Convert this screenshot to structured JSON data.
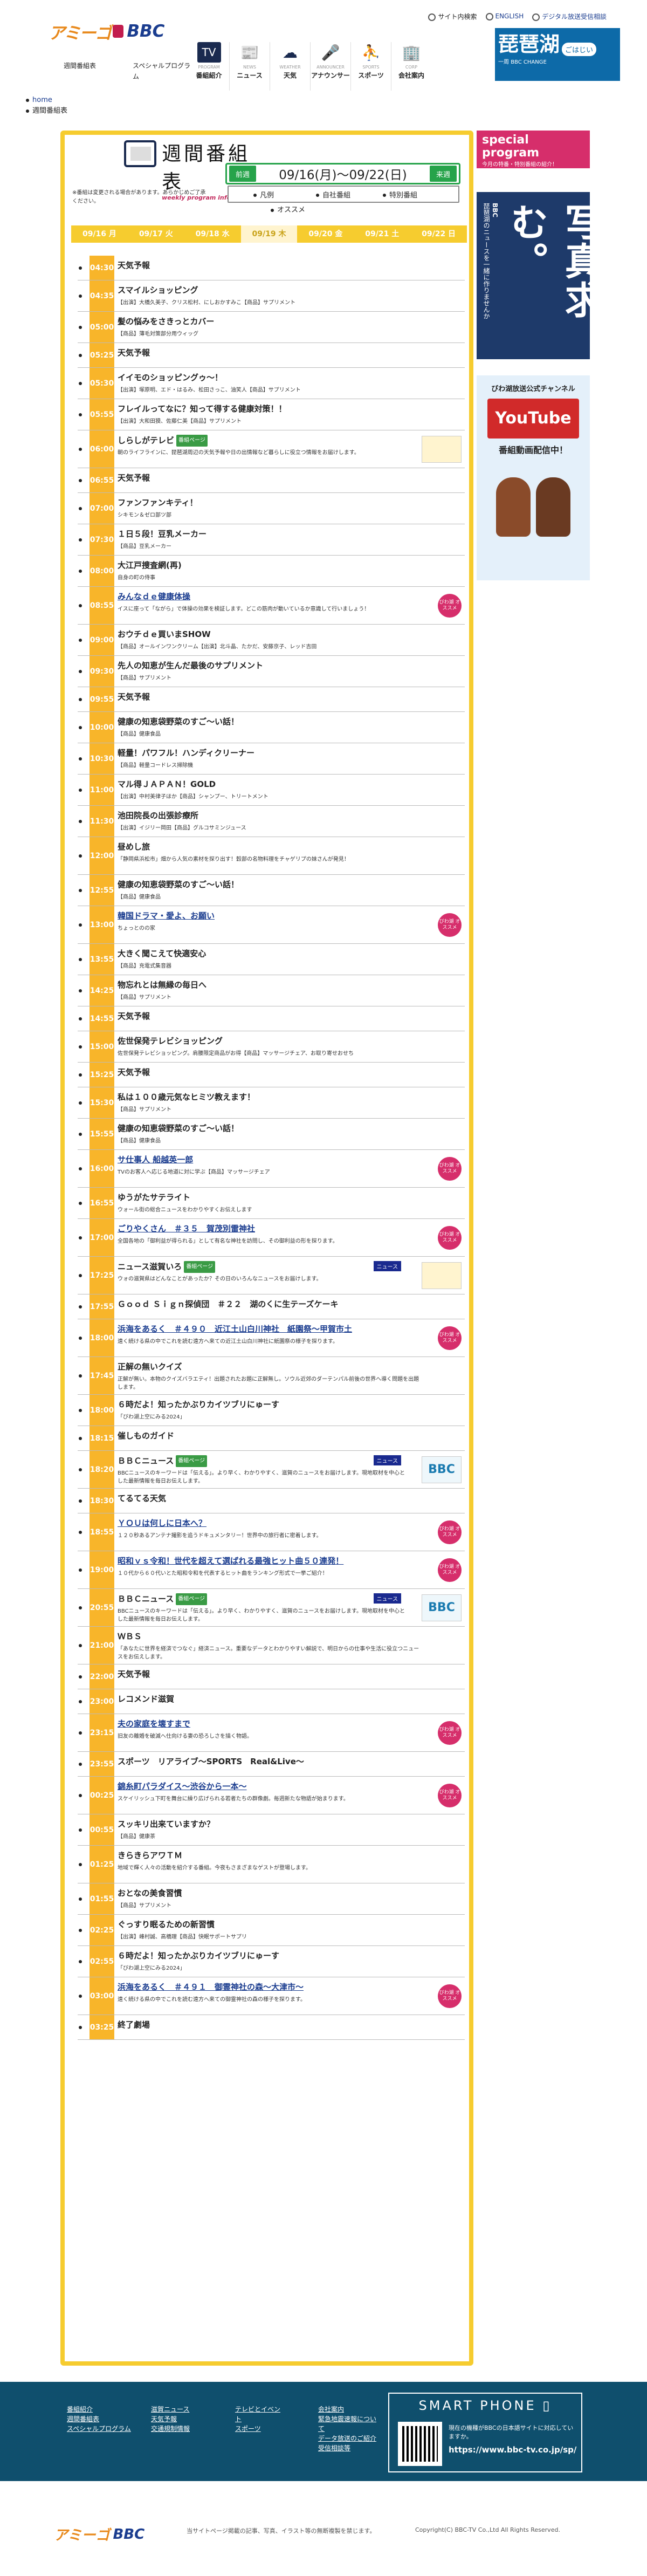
{
  "header": {
    "logo_a": "アミーゴ",
    "logo_b": "BBC",
    "tools": [
      "サイト内検索",
      "ENGLISH",
      "デジタル放送受信相談"
    ],
    "nav": [
      {
        "en": "PROGRAM",
        "ja": "番組紹介",
        "icon": "tv-icon",
        "glyph": "TV",
        "on": true
      },
      {
        "en": "NEWS",
        "ja": "ニュース",
        "icon": "news-icon",
        "glyph": "📰"
      },
      {
        "en": "WEATHER",
        "ja": "天気",
        "icon": "weather-icon",
        "glyph": "☁"
      },
      {
        "en": "ANNOUNCER",
        "ja": "アナウンサー",
        "icon": "microphone-icon",
        "glyph": "🎤"
      },
      {
        "en": "SPORTS",
        "ja": "スポーツ",
        "icon": "sports-icon",
        "glyph": "⛹"
      },
      {
        "en": "CORP",
        "ja": "会社案内",
        "icon": "building-icon",
        "glyph": "🏢"
      }
    ],
    "subnav": [
      "週間番組表",
      "スペシャルプログラム"
    ],
    "banner": {
      "title": "琵琶湖",
      "tag": "ごはじい",
      "sub": "一周",
      "small": "BBC CHANGE"
    }
  },
  "breadcrumb": [
    "home",
    "週間番組表"
  ],
  "page": {
    "title_ja": "週間番組表",
    "title_en": "weekly program information",
    "note": "※番組は変更される場合があります。あらかじめご了承ください。",
    "prev": "前週",
    "next": "来週",
    "range": "09/16(月)～09/22(日)",
    "filters": [
      "凡例",
      "自社番組",
      "特別番組"
    ],
    "recommend": "オススメ",
    "days": [
      "09/16 月",
      "09/17 火",
      "09/18 水",
      "09/19 木",
      "09/20 金",
      "09/21 土",
      "09/22 日"
    ]
  },
  "rows": [
    {
      "t": "04:30",
      "ti": "天気予報",
      "ds": "",
      "h": 34
    },
    {
      "t": "04:35",
      "ti": "スマイルショッピング",
      "ds": "【出演】大橋久美子、クリス松村、にしおかすみこ【商品】サプリメント",
      "h": 46
    },
    {
      "t": "05:00",
      "ti": "髪の悩みをさきっとカバー",
      "ds": "【商品】薄毛対策部分用ウィッグ",
      "h": 46
    },
    {
      "t": "05:25",
      "ti": "天気予報",
      "ds": "",
      "h": 34
    },
    {
      "t": "05:30",
      "ti": "イイモのショッピングゥ〜！",
      "ds": "【出演】塚原明、エド・はるみ、松田さっこ、油笑人【商品】サプリメント",
      "h": 46
    },
    {
      "t": "05:55",
      "ti": "フレイルってなに？知って得する健康対策！！",
      "ds": "【出演】大和田獏、佐藤仁美【商品】サプリメント",
      "h": 46
    },
    {
      "t": "06:00",
      "ti": "しらしがテレビ",
      "ds": "朝のライフラインに、琵琶湖周辺の天気予報や日の出情報など暮らしに役立つ情報をお届けします。",
      "h": 58,
      "badge": "番組ページ",
      "logo": true
    },
    {
      "t": "06:55",
      "ti": "天気予報",
      "ds": "",
      "h": 34
    },
    {
      "t": "07:00",
      "ti": "ファンファンキティ！",
      "ds": "シキモン＆ゼロ部ツ部",
      "h": 46
    },
    {
      "t": "07:30",
      "ti": "１日５段！豆乳メーカー",
      "ds": "【商品】豆乳メーカー",
      "h": 46
    },
    {
      "t": "08:00",
      "ti": "大江戸捜査網(再)",
      "ds": "自身の町の侍事",
      "h": 46
    },
    {
      "t": "08:55",
      "ti": "みんなｄｅ健康体操",
      "ds": "イスに座って「ながら」で体操の効果を検証します。どこの筋肉が動いているか意識して行いましょう！",
      "h": 58,
      "link": true,
      "tag": true
    },
    {
      "t": "09:00",
      "ti": "おウチｄｅ買いまSHOW",
      "ds": "【商品】オールインワンクリーム【出演】北斗晶、たかだ、安藤京子、レッド吉田",
      "h": 46
    },
    {
      "t": "09:30",
      "ti": "先人の知恵が生んだ最後のサプリメント",
      "ds": "【商品】サプリメント",
      "h": 46
    },
    {
      "t": "09:55",
      "ti": "天気予報",
      "ds": "",
      "h": 34
    },
    {
      "t": "10:00",
      "ti": "健康の知恵袋野菜のすご〜い話！",
      "ds": "【商品】健康食品",
      "h": 46
    },
    {
      "t": "10:30",
      "ti": "軽量！パワフル！ハンディクリーナー",
      "ds": "【商品】軽量コードレス掃除機",
      "h": 46
    },
    {
      "t": "11:00",
      "ti": "マル得ＪＡＰＡＮ！GOLD",
      "ds": "【出演】中村美律子ほか【商品】シャンプー、トリートメント",
      "h": 46
    },
    {
      "t": "11:30",
      "ti": "池田院長の出張診療所",
      "ds": "【出演】イジリー岡田【商品】グルコサミンジュース",
      "h": 46
    },
    {
      "t": "12:00",
      "ti": "昼めし旅",
      "ds": "「静岡県浜松市」畑から人気の素材を探り出す！穀部の名物料理をチャゲリプの妹さんが発見！",
      "h": 58
    },
    {
      "t": "12:55",
      "ti": "健康の知恵袋野菜のすご〜い話！",
      "ds": "【商品】健康食品",
      "h": 46
    },
    {
      "t": "13:00",
      "ti": "韓国ドラマ・愛よ、お願い",
      "ds": "ちょっとのの家",
      "h": 58,
      "link": true,
      "tag": true
    },
    {
      "t": "13:55",
      "ti": "大きく聞こえて快適安心",
      "ds": "【商品】充電式集音器",
      "h": 46
    },
    {
      "t": "14:25",
      "ti": "物忘れとは無縁の毎日へ",
      "ds": "【商品】サプリメント",
      "h": 46
    },
    {
      "t": "14:55",
      "ti": "天気予報",
      "ds": "",
      "h": 34
    },
    {
      "t": "15:00",
      "ti": "佐世保発テレビショッピング",
      "ds": "佐世保発テレビショッピング。肩腰限定商品がお得【商品】マッサージチェア、お取り寄せおせち",
      "h": 46
    },
    {
      "t": "15:25",
      "ti": "天気予報",
      "ds": "",
      "h": 34
    },
    {
      "t": "15:30",
      "ti": "私は１００歳元気なヒミツ教えます！",
      "ds": "【商品】サプリメント",
      "h": 46
    },
    {
      "t": "15:55",
      "ti": "健康の知恵袋野菜のすご〜い話！",
      "ds": "【商品】健康食品",
      "h": 46
    },
    {
      "t": "16:00",
      "ti": "サ仕事人 船越英一郎",
      "ds": "TVのお客人へ応じる地道に対に学ぶ【商品】マッサージチェア",
      "h": 58,
      "link": true,
      "tag": true
    },
    {
      "t": "16:55",
      "ti": "ゆうがたサテライト",
      "ds": "ウォール街の総合ニュースをわかりやすくお伝えします",
      "h": 46
    },
    {
      "t": "17:00",
      "ti": "ごりやくさん　＃３５　賀茂別雷神社",
      "ds": "全国各地の「御利益が得られる」として有名な神社を訪問し、その御利益の形を探ります。",
      "h": 58,
      "link": true,
      "tag": true
    },
    {
      "t": "17:25",
      "ti": "ニュース滋賀いろ",
      "ds": "ウォの滋賀県はどんなことがあったか？その日のいろんなニュースをお届けします。",
      "h": 58,
      "badge": "番組ページ",
      "news": true,
      "logo": true
    },
    {
      "t": "17:55",
      "ti": "Ｇｏｏｄ Ｓｉｇｎ探偵団　＃２２　湖のくに生テーズケーキ",
      "ds": "",
      "h": 34
    },
    {
      "t": "18:00",
      "ti": "浜海をあるく　＃４９０　近江土山白川神社　紙園祭〜甲賀市土",
      "ds": "遠く続ける県の中でこれを読む遠方へ来ての近江土山白川神社に紙園祭の様子を探ります。",
      "h": 58,
      "link": true,
      "tag": true
    },
    {
      "t": "17:45",
      "ti": "正解の無いクイズ",
      "ds": "正解が無い。本物のクイズバラエティ！出題されたお題に正解無し。ソウル近郊のダーテンパル前後の世界へ導く問題を出題します。",
      "h": 58
    },
    {
      "t": "18:00",
      "ti": "６時だよ！知ったかぶりカイツブリにゅーす",
      "ds": "「びわ湖上空にみる2024」",
      "h": 46
    },
    {
      "t": "18:15",
      "ti": "催しものガイド",
      "ds": "",
      "h": 34
    },
    {
      "t": "18:20",
      "ti": "ＢＢＣニュース",
      "ds": "BBCニュースのキーワードは「伝える」。より早く、わかりやすく、滋賀のニュースをお届けします。現地取材を中心とした最新情報を毎日お伝えします。",
      "h": 58,
      "badge": "番組ページ",
      "news": true,
      "bbc": true
    },
    {
      "t": "18:30",
      "ti": "てるてる天気",
      "ds": "",
      "h": 34
    },
    {
      "t": "18:55",
      "ti": "ＹＯＵは何しに日本へ？",
      "ds": "１２０秒あるアンテナ撮影を追うドキュメンタリー！世界中の旅行者に密着します。",
      "h": 58,
      "link": true,
      "tag": true
    },
    {
      "t": "19:00",
      "ti": "昭和ｖｓ令和！世代を超えて選ばれる最強ヒット曲５０連発！",
      "ds": "１０代から６０代いとた昭和令和を代表するヒット曲をランキング形式で一挙ご紹介！",
      "h": 58,
      "link": true,
      "tag": true
    },
    {
      "t": "20:55",
      "ti": "ＢＢＣニュース",
      "ds": "BBCニュースのキーワードは「伝える」。より早く、わかりやすく、滋賀のニュースをお届けします。現地取材を中心とした最新情報を毎日お伝えします。",
      "h": 58,
      "badge": "番組ページ",
      "news": true,
      "bbc": true
    },
    {
      "t": "21:00",
      "ti": "ＷＢＳ",
      "ds": "「あなたに世界を経済でつなぐ」経済ニュース。重要なデータとわかりやすい解説で、明日からの仕事や生活に役立つニュースをお伝えします。",
      "h": 58
    },
    {
      "t": "22:00",
      "ti": "天気予報",
      "ds": "",
      "h": 34
    },
    {
      "t": "23:00",
      "ti": "レコメンド滋賀",
      "ds": "",
      "h": 34
    },
    {
      "t": "23:15",
      "ti": "夫の家庭を壊すまで",
      "ds": "旧友の離婚を破滅へ仕向ける妻の恐ろしさを描く物語。",
      "h": 58,
      "link": true,
      "tag": true
    },
    {
      "t": "23:55",
      "ti": "スポーツ　リアライブ〜SPORTS　Real&Live〜",
      "ds": "",
      "h": 34
    },
    {
      "t": "00:25",
      "ti": "錦糸町パラダイス〜渋谷から一本〜",
      "ds": "スケイリッシュ下町を舞台に繰り広げられる若者たちの群像劇。毎週新たな物語が始まります。",
      "h": 58,
      "link": true,
      "tag": true
    },
    {
      "t": "00:55",
      "ti": "スッキリ出来ていますか？",
      "ds": "【商品】健康茶",
      "h": 46
    },
    {
      "t": "01:25",
      "ti": "きらきらアワＴＭ",
      "ds": "地域で輝く人々の活動を紹介する番組。今夜もさまざまなゲストが登場します。",
      "h": 58
    },
    {
      "t": "01:55",
      "ti": "おとなの美食習慣",
      "ds": "【商品】サプリメント",
      "h": 46
    },
    {
      "t": "02:25",
      "ti": "ぐっすり眠るための新習慣",
      "ds": "【出演】峰村誠、高橋理【商品】快眠サポートサプリ",
      "h": 46
    },
    {
      "t": "02:55",
      "ti": "６時だよ！知ったかぶりカイツブリにゅーす",
      "ds": "「びわ湖上空にみる2024」",
      "h": 46
    },
    {
      "t": "03:00",
      "ti": "浜海をあるく　＃４９１　御霊神社の森〜大津市〜",
      "ds": "遠く続ける県の中でこれを読む遠方へ来ての御霊神社の森の様子を探ります。",
      "h": 58,
      "link": true,
      "tag": true
    },
    {
      "t": "03:25",
      "ti": "終了劇場",
      "ds": "",
      "h": 34
    }
  ],
  "labels": {
    "tag": "びわ湖\nオススメ",
    "news": "ニュース",
    "bbc": "BBC"
  },
  "side": {
    "special_a": "special",
    "special_b": "program",
    "special_c": "今月の特番・特別番組の紹介！",
    "bbc_title": "BBC",
    "bbc_big": "写真求む。",
    "bbc_small": "琵琶湖のニュースを一緒に作りませんか",
    "yt_title": "びわ湖放送公式チャンネル",
    "yt": "YouTube",
    "yt_sub": "番組動画配信中！"
  },
  "footer": {
    "col1": [
      "番組紹介",
      "週間番組表",
      "スペシャルプログラム"
    ],
    "col2": [
      "滋賀ニュース",
      "天気予報",
      "交通規制情報"
    ],
    "col3": [
      "テレビとイベント",
      "スポーツ"
    ],
    "col4": [
      "会社案内",
      "緊急地震速報について",
      "データ放送のご紹介",
      "受信相談等"
    ],
    "sp_title": "SMART PHONE",
    "sp_text": "現在の機種がBBCの日本語サイトに対応していますか。",
    "sp_url": "https://www.bbc-tv.co.jp/sp/",
    "note": "当サイトページ掲載の記事、写真、イラスト等の無断複製を禁じます。",
    "copy": "Copyright(C) BBC-TV Co.,Ltd All Rights Reserved."
  }
}
